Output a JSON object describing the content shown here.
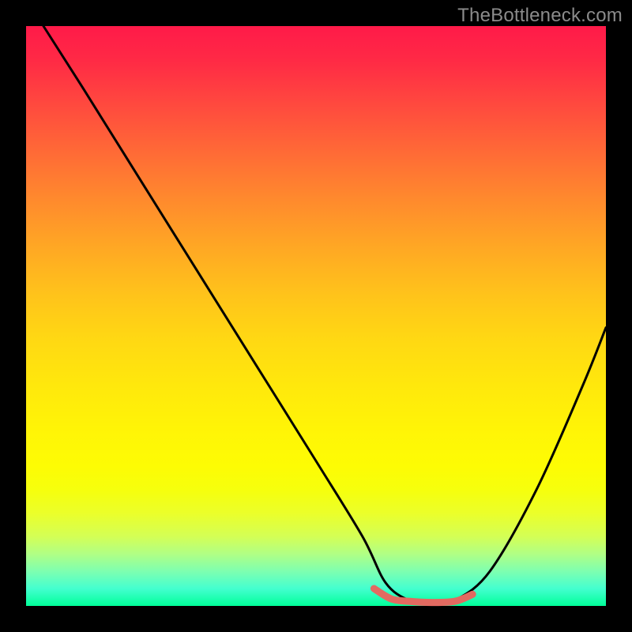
{
  "watermark": "TheBottleneck.com",
  "chart_data": {
    "type": "line",
    "title": "",
    "xlabel": "",
    "ylabel": "",
    "xlim": [
      0,
      100
    ],
    "ylim": [
      0,
      100
    ],
    "grid": false,
    "series": [
      {
        "name": "bottleneck-curve",
        "color": "#000000",
        "x": [
          3,
          10,
          20,
          30,
          40,
          50,
          58,
          62,
          66,
          70,
          74,
          80,
          88,
          96,
          100
        ],
        "values": [
          100,
          89,
          73,
          57,
          41,
          25,
          12,
          4,
          1,
          0.5,
          1,
          6,
          20,
          38,
          48
        ]
      },
      {
        "name": "sweet-spot",
        "color": "#e26a61",
        "x": [
          60,
          63,
          66,
          70,
          74,
          77
        ],
        "values": [
          3.0,
          1.2,
          0.8,
          0.6,
          0.8,
          2.0
        ]
      }
    ],
    "gradient_stops": [
      {
        "pos": 0.0,
        "color": "#ff1a49"
      },
      {
        "pos": 0.5,
        "color": "#ffd813"
      },
      {
        "pos": 0.8,
        "color": "#f6ff0d"
      },
      {
        "pos": 1.0,
        "color": "#00ff99"
      }
    ]
  }
}
